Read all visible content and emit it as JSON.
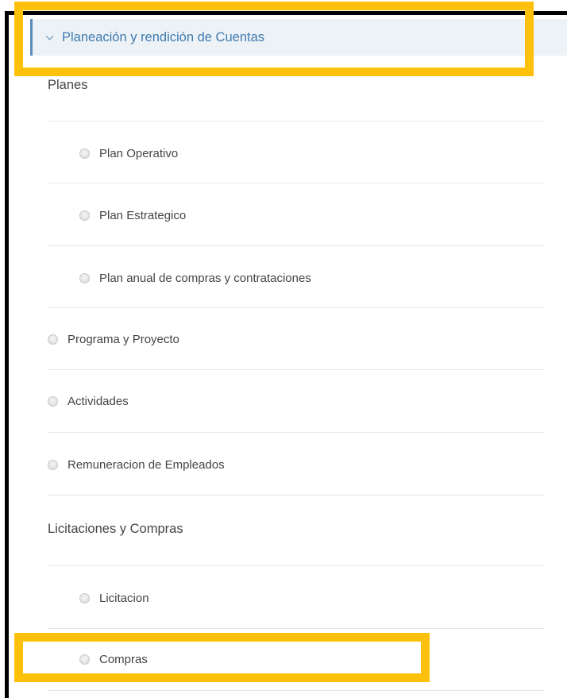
{
  "accordion": {
    "title": "Planeación y rendición de Cuentas",
    "expanded": true,
    "accent_color": "#3f7ab0"
  },
  "highlight_color": "#fdc10c",
  "groups": [
    {
      "title": "Planes",
      "items": [
        {
          "label": "Plan Operativo",
          "checked": false
        },
        {
          "label": "Plan Estrategico",
          "checked": false
        },
        {
          "label": "Plan anual de compras y contrataciones",
          "checked": false
        }
      ]
    },
    {
      "items": [
        {
          "label": "Programa y Proyecto",
          "checked": false
        },
        {
          "label": "Actividades",
          "checked": false
        },
        {
          "label": "Remuneracion de Empleados",
          "checked": false
        }
      ]
    },
    {
      "title": "Licitaciones y Compras",
      "items": [
        {
          "label": "Licitacion",
          "checked": false
        },
        {
          "label": "Compras",
          "checked": false
        }
      ]
    }
  ]
}
